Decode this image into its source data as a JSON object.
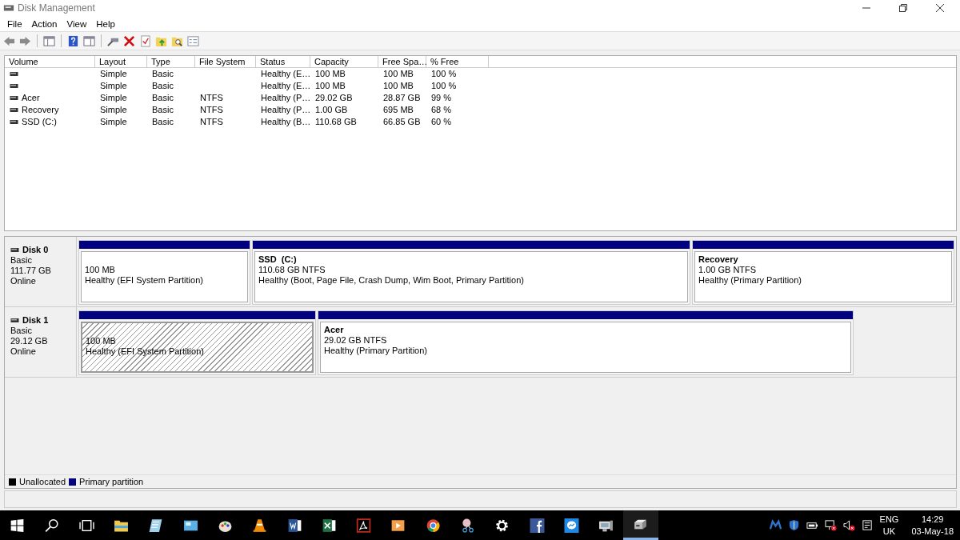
{
  "window": {
    "title": "Disk Management"
  },
  "menu": [
    "File",
    "Action",
    "View",
    "Help"
  ],
  "volume_list": {
    "columns": [
      "Volume",
      "Layout",
      "Type",
      "File System",
      "Status",
      "Capacity",
      "Free Spa…",
      "% Free"
    ],
    "rows": [
      {
        "layout": "Simple",
        "type": "Basic",
        "status": "Healthy (E…",
        "capacity": "100 MB",
        "free_space": "100 MB",
        "percent_free": "100 %"
      },
      {
        "layout": "Simple",
        "type": "Basic",
        "status": "Healthy (E…",
        "capacity": "100 MB",
        "free_space": "100 MB",
        "percent_free": "100 %"
      },
      {
        "volume": "Acer",
        "layout": "Simple",
        "type": "Basic",
        "file_system": "NTFS",
        "status": "Healthy (P…",
        "capacity": "29.02 GB",
        "free_space": "28.87 GB",
        "percent_free": "99 %"
      },
      {
        "volume": "Recovery",
        "layout": "Simple",
        "type": "Basic",
        "file_system": "NTFS",
        "status": "Healthy (P…",
        "capacity": "1.00 GB",
        "free_space": "695 MB",
        "percent_free": "68 %"
      },
      {
        "volume": "SSD (C:)",
        "layout": "Simple",
        "type": "Basic",
        "file_system": "NTFS",
        "status": "Healthy (B…",
        "capacity": "110.68 GB",
        "free_space": "66.85 GB",
        "percent_free": "60 %"
      }
    ]
  },
  "disks": [
    {
      "name": "Disk 0",
      "type": "Basic",
      "size": "111.77 GB",
      "state": "Online",
      "partitions": [
        {
          "size": "100 MB",
          "status": "Healthy (EFI System Partition)",
          "selected": false
        },
        {
          "name": "SSD  (C:)",
          "size": "110.68 GB NTFS",
          "status": "Healthy (Boot, Page File, Crash Dump, Wim Boot, Primary Partition)",
          "selected": false
        },
        {
          "name": "Recovery",
          "size": "1.00 GB NTFS",
          "status": "Healthy (Primary Partition)",
          "selected": false
        }
      ]
    },
    {
      "name": "Disk 1",
      "type": "Basic",
      "size": "29.12 GB",
      "state": "Online",
      "partitions": [
        {
          "size": "100 MB",
          "status": "Healthy (EFI System Partition)",
          "selected": true
        },
        {
          "name": "Acer",
          "size": "29.02 GB NTFS",
          "status": "Healthy (Primary Partition)",
          "selected": false
        }
      ]
    }
  ],
  "legend": [
    {
      "label": "Unallocated",
      "color": "#000000"
    },
    {
      "label": "Primary partition",
      "color": "#000080"
    }
  ],
  "taskbar": {
    "buttons": [
      {
        "kind": "start",
        "selected": false
      },
      {
        "kind": "search",
        "selected": false
      },
      {
        "kind": "taskview",
        "selected": false
      },
      {
        "kind": "folder",
        "selected": false
      },
      {
        "kind": "notepad",
        "selected": false
      },
      {
        "kind": "screen",
        "selected": false
      },
      {
        "kind": "paint",
        "selected": false
      },
      {
        "kind": "cone",
        "selected": false
      },
      {
        "kind": "word",
        "selected": false
      },
      {
        "kind": "excel",
        "selected": false
      },
      {
        "kind": "pdf",
        "selected": false
      },
      {
        "kind": "player",
        "selected": false
      },
      {
        "kind": "chrome",
        "selected": false
      },
      {
        "kind": "scissors",
        "selected": false
      },
      {
        "kind": "gear",
        "selected": false
      },
      {
        "kind": "facebook",
        "selected": false
      },
      {
        "kind": "messenger",
        "selected": false
      },
      {
        "kind": "monitor",
        "selected": false
      },
      {
        "kind": "drive",
        "selected": true
      }
    ],
    "language": [
      "ENG",
      "UK"
    ],
    "time": "14:29",
    "date": "03-May-18"
  }
}
